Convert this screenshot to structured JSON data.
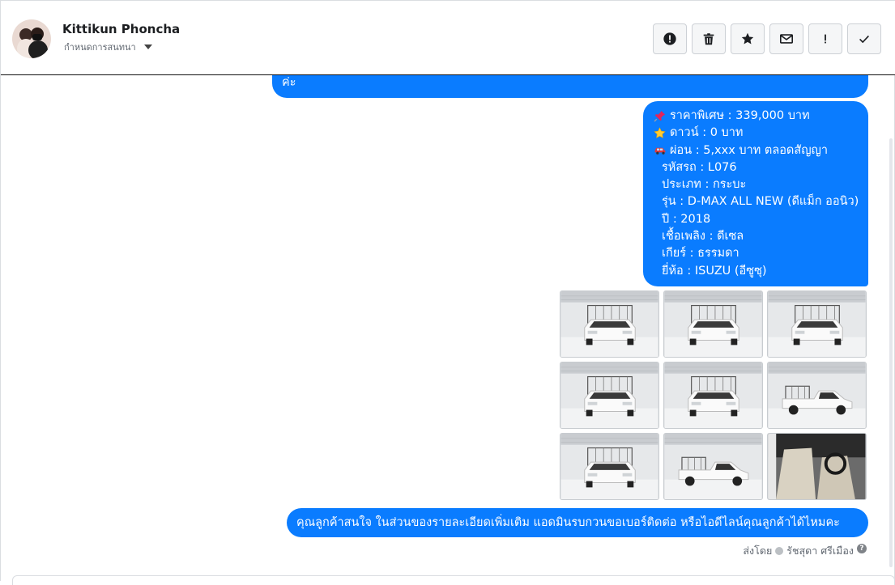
{
  "contact": {
    "name": "Kittikun Phoncha",
    "subtitle": "กำหนดการสนทนา"
  },
  "toolbar": {
    "buttons": [
      {
        "icon": "alert-circle-icon"
      },
      {
        "icon": "trash-icon"
      },
      {
        "icon": "star-icon"
      },
      {
        "icon": "envelope-icon"
      },
      {
        "icon": "exclamation-icon"
      },
      {
        "icon": "check-icon"
      }
    ]
  },
  "messages": {
    "top_fragment": "ค่ะ",
    "info_lines": [
      {
        "emoji": "pushpin-icon",
        "text": "ราคาพิเศษ : 339,000 บาท"
      },
      {
        "emoji": "star-emoji-icon",
        "text": "ดาวน์ : 0 บาท"
      },
      {
        "emoji": "car-icon",
        "text": "ผ่อน : 5,xxx บาท ตลอดสัญญา"
      },
      {
        "emoji": "",
        "text": "รหัสรถ : L076"
      },
      {
        "emoji": "",
        "text": "ประเภท : กระบะ"
      },
      {
        "emoji": "",
        "text": "รุ่น : D-MAX ALL NEW (ดีแม็ก ออนิว)"
      },
      {
        "emoji": "",
        "text": "ปี : 2018"
      },
      {
        "emoji": "",
        "text": "เชื้อเพลิง : ดีเซล"
      },
      {
        "emoji": "",
        "text": "เกียร์ : ธรรมดา"
      },
      {
        "emoji": "",
        "text": "ยี่ห้อ : ISUZU (อีซูซุ)"
      }
    ],
    "question": "คุณลูกค้าสนใจ ในส่วนของรายละเอียดเพิ่มเติม แอดมินรบกวนขอเบอร์ติดต่อ หรือไอดีไลน์คุณลูกค้าได้ไหมคะ",
    "sent_by_label": "ส่งโดย",
    "sent_by_name": "รัชสุดา ศรีเมือง"
  },
  "photos": [
    {
      "view": "front-left"
    },
    {
      "view": "rear-right"
    },
    {
      "view": "front"
    },
    {
      "view": "rear"
    },
    {
      "view": "rear-left"
    },
    {
      "view": "side-right"
    },
    {
      "view": "front-left-2"
    },
    {
      "view": "side-left"
    },
    {
      "view": "interior"
    }
  ],
  "colors": {
    "bubble": "#0a7cff",
    "bubble_text": "#ffffff"
  }
}
